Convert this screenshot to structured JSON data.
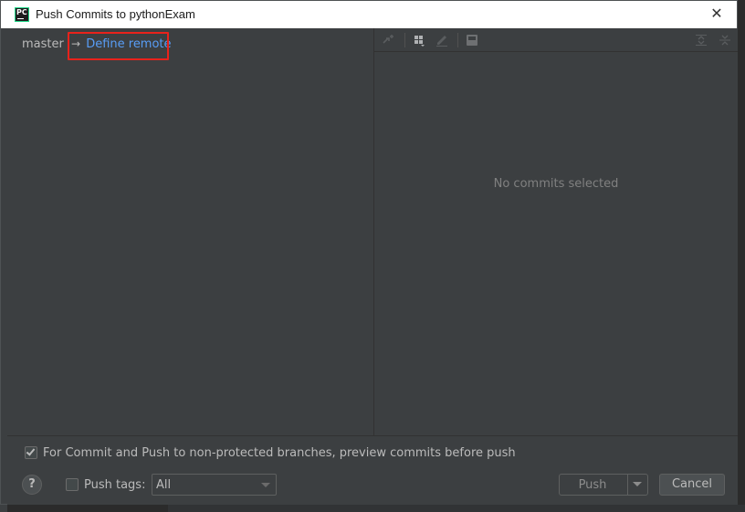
{
  "window": {
    "title": "Push Commits to pythonExam",
    "app_icon": "pycharm-icon",
    "app_icon_text": "PC",
    "close_icon": "close-icon",
    "close_glyph": "✕"
  },
  "left": {
    "branch": "master",
    "arrow": "→",
    "define_remote": "Define remote",
    "link_color": "#589df6",
    "highlight_color": "#e8221b"
  },
  "toolbar": {
    "icons": [
      "cherry-pick-icon",
      "group-by-icon",
      "edit-icon",
      "save-icon",
      "expand-all-icon",
      "collapse-all-icon"
    ]
  },
  "right": {
    "empty_text": "No commits selected"
  },
  "bottom": {
    "preview_checked": true,
    "preview_label": "For Commit and Push to non-protected branches, preview commits before push",
    "help_label": "?",
    "push_tags_checked": false,
    "push_tags_label": "Push tags:",
    "tags_select_value": "All",
    "push_label": "Push",
    "cancel_label": "Cancel"
  }
}
